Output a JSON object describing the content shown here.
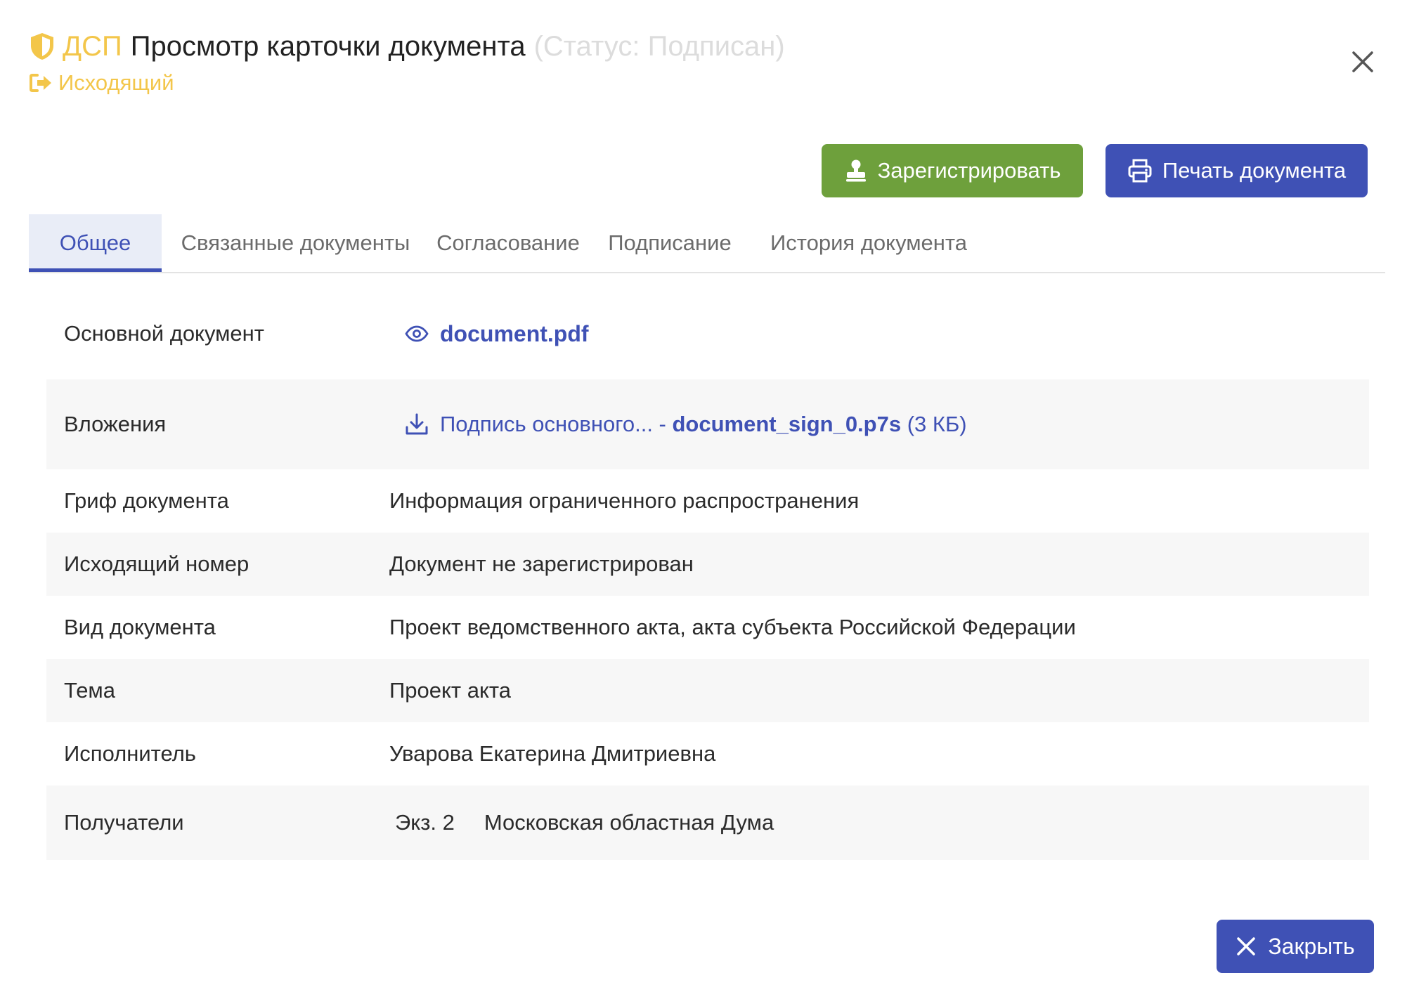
{
  "header": {
    "classification": "ДСП",
    "title": "Просмотр карточки документа",
    "status": "(Статус: Подписан)",
    "direction": "Исходящий",
    "accent_color": "#f3c64a"
  },
  "actions": {
    "register_label": "Зарегистрировать",
    "print_label": "Печать документа",
    "register_color": "#6ea03c",
    "primary_color": "#3f51b5"
  },
  "tabs": [
    {
      "label": "Общее",
      "active": true
    },
    {
      "label": "Связанные документы",
      "active": false
    },
    {
      "label": "Согласование",
      "active": false
    },
    {
      "label": "Подписание",
      "active": false
    },
    {
      "label": "История документа",
      "active": false
    }
  ],
  "fields": {
    "main_document": {
      "label": "Основной документ",
      "file": "document.pdf"
    },
    "attachments": {
      "label": "Вложения",
      "name_prefix": "Подпись основного... -",
      "file": "document_sign_0.p7s",
      "size": "(3 КБ)"
    },
    "classification": {
      "label": "Гриф документа",
      "value": "Информация ограниченного распространения"
    },
    "outgoing_number": {
      "label": "Исходящий номер",
      "value": "Документ не зарегистрирован"
    },
    "doc_type": {
      "label": "Вид документа",
      "value": "Проект ведомственного акта, акта субъекта Российской Федерации"
    },
    "subject": {
      "label": "Тема",
      "value": "Проект акта"
    },
    "executor": {
      "label": "Исполнитель",
      "value": "Уварова Екатерина Дмитриевна"
    },
    "recipients": {
      "label": "Получатели",
      "copies": "Экз. 2",
      "recipient": "Московская областная Дума"
    }
  },
  "footer": {
    "close_label": "Закрыть"
  }
}
